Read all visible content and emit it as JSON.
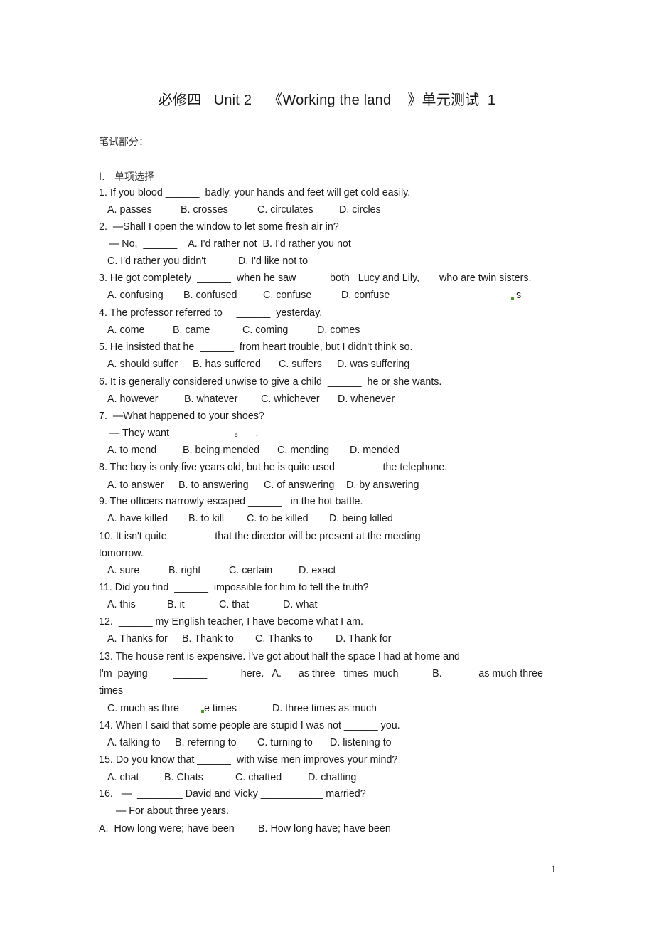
{
  "document": {
    "title": "必修四   Unit 2    《Working the land    》单元测试  1",
    "section": "笔试部分：",
    "subsection_num": "I.",
    "subsection_label": "单项选择",
    "page_number": "1"
  },
  "questions": [
    {
      "stem": "1. If you blood ______  badly, your hands and feet will get cold easily.",
      "options": [
        "A. passes",
        "B. crosses",
        "C. circulates",
        "D. circles"
      ]
    },
    {
      "stem": "2.  —Shall I open the window to let some fresh air in?",
      "stem2": "— No,  ______    A. I'd rather not  B. I'd rather you not",
      "options": [
        "C. I'd rather you didn't",
        "D. I'd like not to"
      ]
    },
    {
      "stem": "3. He got completely  ______  when he saw            both   Lucy and Lily,       who are twin sisters.",
      "options": [
        "A. confusing",
        "B. confused",
        "C. confuse",
        "D. confuse"
      ],
      "trailing": "s"
    },
    {
      "stem": "4. The professor referred to     ______  yesterday.",
      "options": [
        "A. come",
        "B. came",
        "C. coming",
        "D. comes"
      ]
    },
    {
      "stem": "5. He insisted that he  ______  from heart trouble, but I didn't think so.",
      "options": [
        "A. should suffer",
        "B. has suffered",
        "C. suffers",
        "D. was suffering"
      ]
    },
    {
      "stem": "6. It is generally considered unwise to give a child  ______  he or she wants.",
      "options": [
        "A. however",
        "B. whatever",
        "C. whichever",
        "D. whenever"
      ]
    },
    {
      "stem": "7.  —What happened to your shoes?",
      "stem2": "— They want  ______         。    .",
      "options": [
        "A. to mend",
        "B. being mended",
        "C. mending",
        "D. mended"
      ]
    },
    {
      "stem": "8. The boy is only five years old, but he is quite used   ______  the telephone.",
      "options": [
        "A. to answer",
        "B. to answering",
        "C. of answering",
        "D. by answering"
      ]
    },
    {
      "stem": "9. The officers narrowly escaped ______   in the hot battle.",
      "options": [
        "A. have killed",
        "B. to kill",
        "C. to be killed",
        "D. being killed"
      ]
    },
    {
      "stem": "10. It isn't quite  ______   that the director will be present at the meeting",
      "stem2": "tomorrow.",
      "options": [
        "A. sure",
        "B. right",
        "C. certain",
        "D. exact"
      ]
    },
    {
      "stem": "11. Did you find  ______  impossible for him to tell the truth?",
      "options": [
        "A. this",
        "B. it",
        "C. that",
        "D. what"
      ]
    },
    {
      "stem": "12.  ______ my English teacher, I have become what I am.",
      "options": [
        "A. Thanks for",
        "B. Thank to",
        "C. Thanks to",
        "D. Thank for"
      ]
    },
    {
      "stem": "13. The house rent is expensive. I've got about half the space I had at home and",
      "stem2": "I'm  paying         ______            here.   A.      as three   times  much            B.             as much three",
      "stem3": "times",
      "options": [
        "C. much as thre",
        "e times",
        "D. three times as much"
      ]
    },
    {
      "stem": "14. When I said that some people are stupid I was not ______ you.",
      "options": [
        "A. talking to",
        "B. referring to",
        "C. turning to",
        "D. listening to"
      ]
    },
    {
      "stem": "15. Do you know that ______  with wise men improves your mind?",
      "options": [
        "A. chat",
        "B. Chats",
        "C. chatted",
        "D. chatting"
      ]
    },
    {
      "stem": "16.   —  ________ David and Vicky ___________ married?",
      "stem2": "— For about three years.",
      "options": [
        "A.  How long were; have been",
        "B. How long have; have been"
      ]
    }
  ]
}
